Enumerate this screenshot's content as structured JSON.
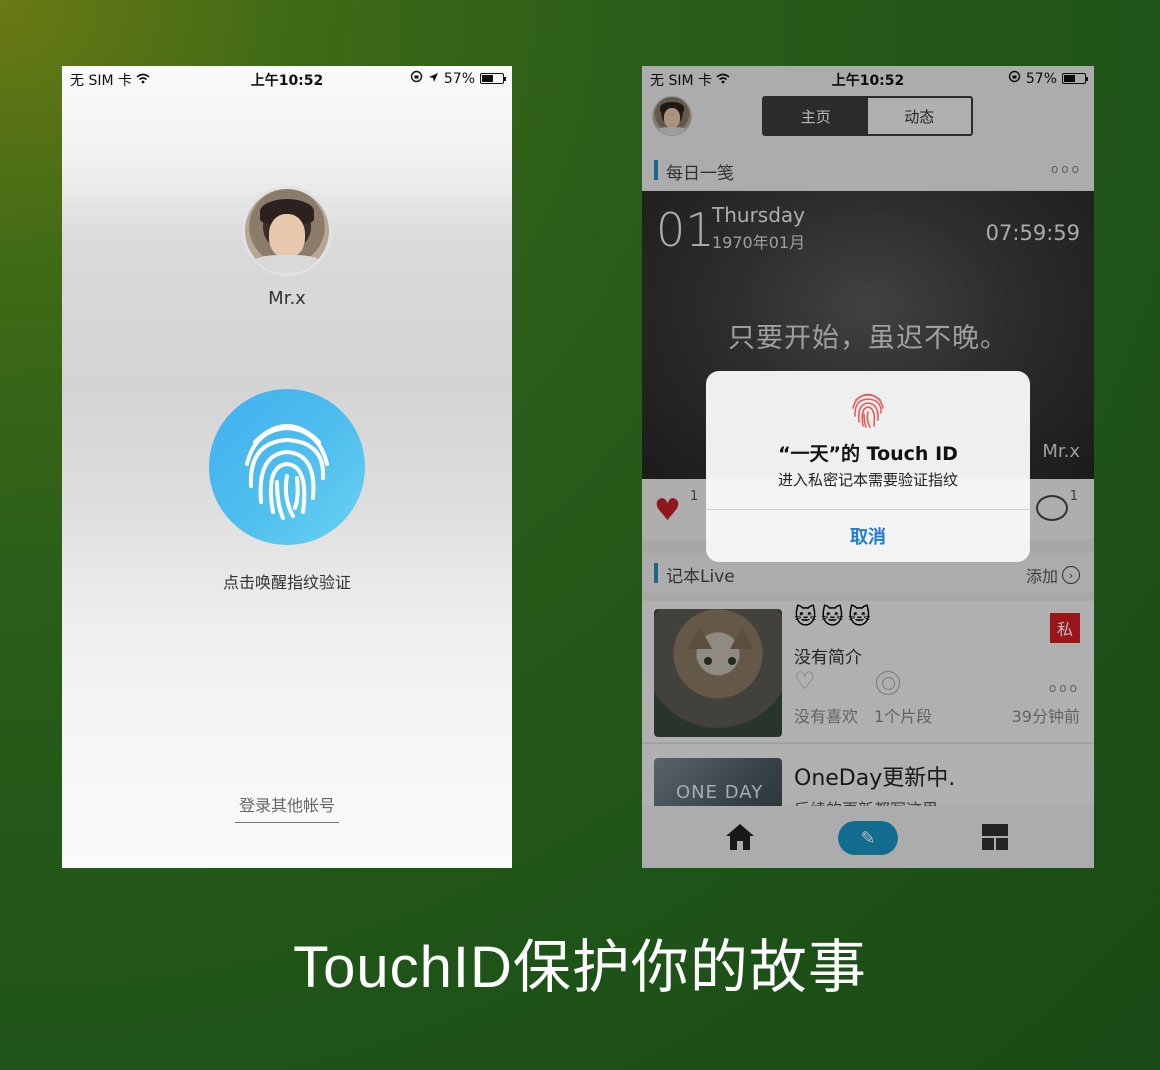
{
  "left_screen": {
    "status": {
      "carrier": "无 SIM 卡",
      "time": "上午10:52",
      "battery": "57%",
      "battery_level": 0.57
    },
    "username": "Mr.x",
    "fingerprint_hint": "点击唤醒指纹验证",
    "other_account": "登录其他帐号"
  },
  "right_screen": {
    "status": {
      "carrier": "无 SIM 卡",
      "time": "上午10:52",
      "battery": "57%",
      "battery_level": 0.57
    },
    "tabs": [
      {
        "label": "主页",
        "active": true
      },
      {
        "label": "动态",
        "active": false
      }
    ],
    "daily": {
      "section_title": "每日一笺",
      "more": "ooo",
      "day": "01",
      "weekday": "Thursday",
      "date": "1970年01月",
      "time": "07:59:59",
      "quote": "只要开始，虽迟不晚。",
      "author": "Mr.x",
      "like_count": "1",
      "comment_count": "1"
    },
    "live": {
      "section_title": "记本Live",
      "add_label": "添加",
      "notes": [
        {
          "emoji": "🐱🐱🐱",
          "description": "没有简介",
          "private_badge": "私",
          "likes": "没有喜欢",
          "fragments": "1个片段",
          "time_ago": "39分钟前",
          "more": "ooo"
        },
        {
          "thumb_logo": "ONE DAY",
          "title": "OneDay更新中.",
          "subtitle": "后续的更新都写这里"
        }
      ]
    },
    "alert": {
      "title": "“一天”的 Touch ID",
      "message": "进入私密记本需要验证指纹",
      "cancel": "取消"
    }
  },
  "caption": "TouchID保护你的故事",
  "colors": {
    "accent_blue": "#2a8fc2",
    "fingerprint_blue": "#4dbdee",
    "alert_button": "#1d7ae0",
    "private_red": "#d61f26",
    "heart_red": "#c8202a"
  }
}
